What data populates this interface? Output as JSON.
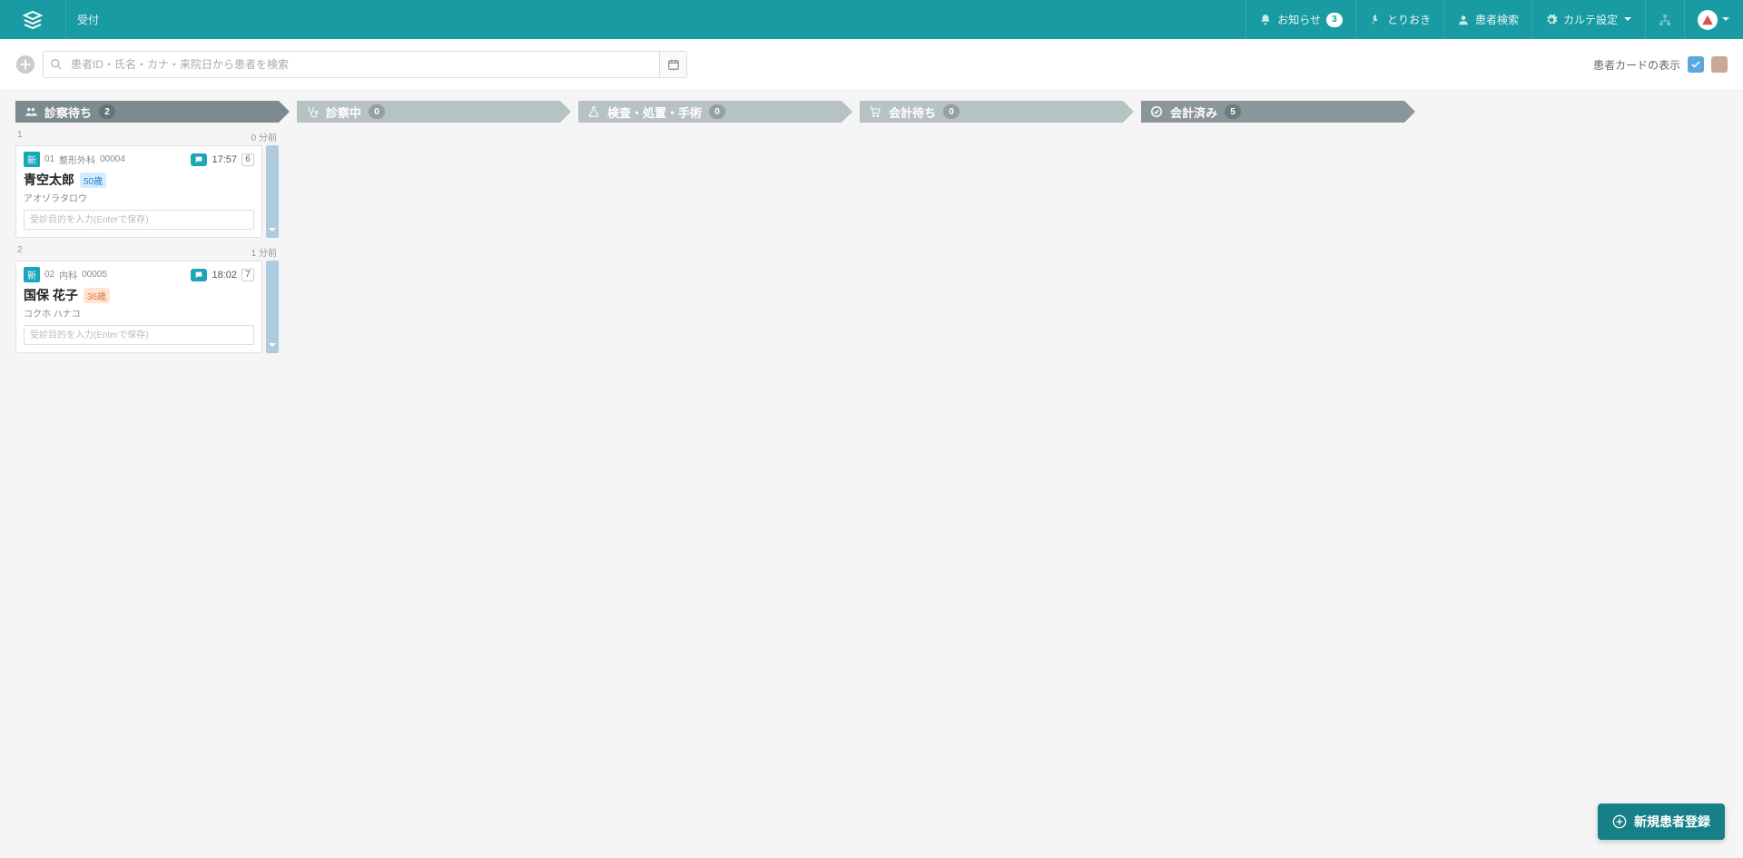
{
  "header": {
    "title": "受付",
    "nav": {
      "notice_label": "お知らせ",
      "notice_count": "3",
      "pin_label": "とりおき",
      "search_label": "患者検索",
      "settings_label": "カルテ設定"
    }
  },
  "toolbar": {
    "search_placeholder": "患者ID・氏名・カナ・来院日から患者を検索",
    "card_toggle_label": "患者カードの表示"
  },
  "columns": [
    {
      "label": "診察待ち",
      "count": "2",
      "style": "dark",
      "icon": "users"
    },
    {
      "label": "診察中",
      "count": "0",
      "style": "light",
      "icon": "stethoscope"
    },
    {
      "label": "検査・処置・手術",
      "count": "0",
      "style": "light",
      "icon": "flask"
    },
    {
      "label": "会計待ち",
      "count": "0",
      "style": "light",
      "icon": "cart"
    },
    {
      "label": "会計済み",
      "count": "5",
      "style": "mid",
      "icon": "check"
    }
  ],
  "cards": [
    {
      "index": "1",
      "elapsed": "0 分前",
      "tag": "新",
      "seq": "01",
      "dept": "整形外科",
      "pid": "00004",
      "time": "17:57",
      "num": "6",
      "name": "青空太郎",
      "age": "50歳",
      "age_style": "blue",
      "kana": "アオゾラタロウ",
      "purpose_placeholder": "受診目的を入力(Enterで保存)"
    },
    {
      "index": "2",
      "elapsed": "1 分前",
      "tag": "新",
      "seq": "02",
      "dept": "内科",
      "pid": "00005",
      "time": "18:02",
      "num": "7",
      "name": "国保 花子",
      "age": "36歳",
      "age_style": "orange",
      "kana": "コクホ ハナコ",
      "purpose_placeholder": "受診目的を入力(Enterで保存)"
    }
  ],
  "fab_label": "新規患者登録"
}
